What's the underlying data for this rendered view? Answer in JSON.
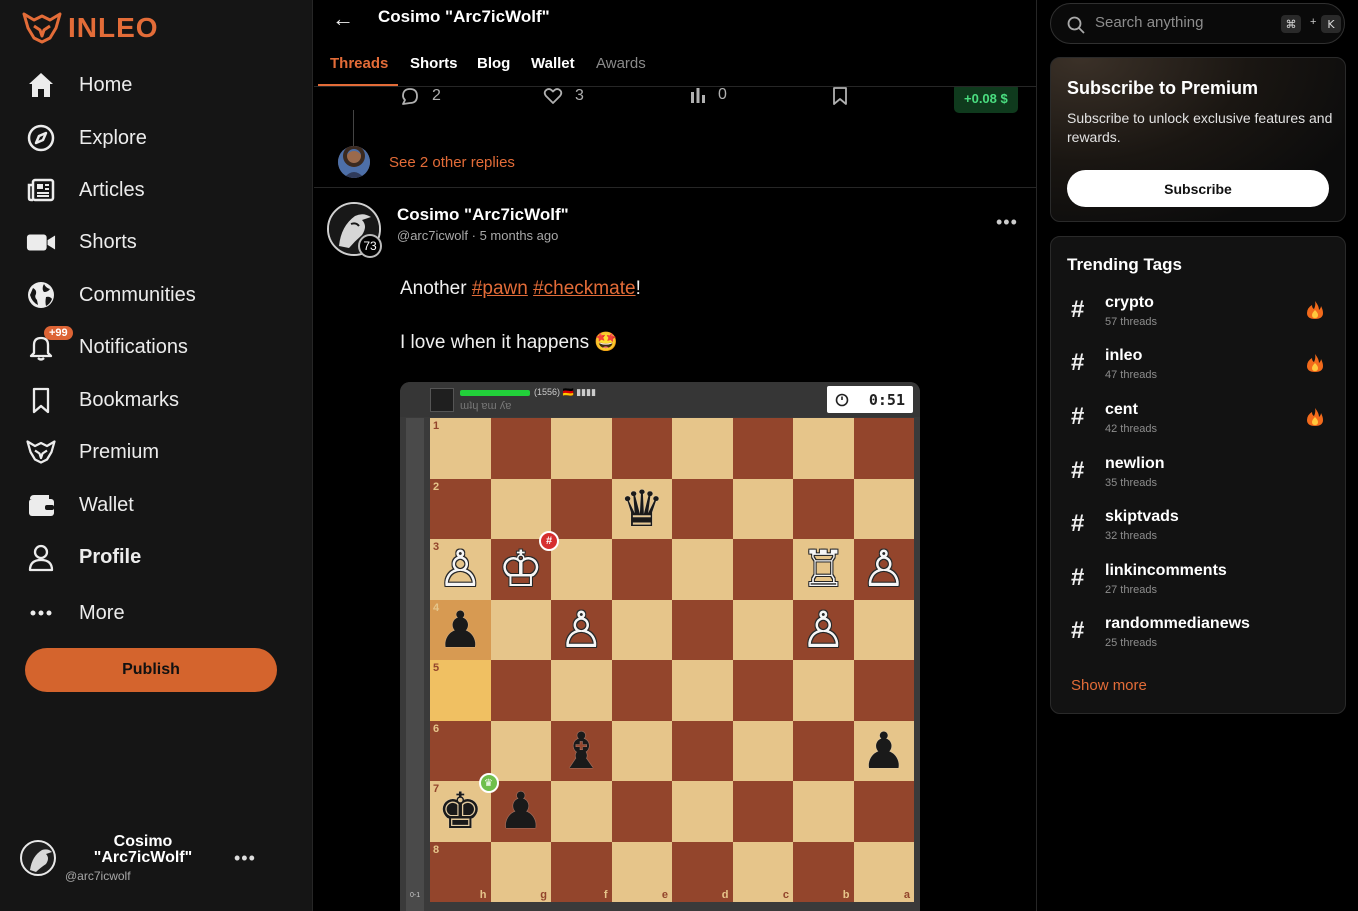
{
  "brand": {
    "name": "INLEO",
    "accent": "#e36c38"
  },
  "sidebar": {
    "items": [
      {
        "label": "Home",
        "icon": "home-icon"
      },
      {
        "label": "Explore",
        "icon": "compass-icon"
      },
      {
        "label": "Articles",
        "icon": "newspaper-icon"
      },
      {
        "label": "Shorts",
        "icon": "video-icon"
      },
      {
        "label": "Communities",
        "icon": "globe-icon"
      },
      {
        "label": "Notifications",
        "icon": "bell-icon",
        "badge": "+99"
      },
      {
        "label": "Bookmarks",
        "icon": "bookmark-icon"
      },
      {
        "label": "Premium",
        "icon": "leo-logo-icon"
      },
      {
        "label": "Wallet",
        "icon": "wallet-icon"
      },
      {
        "label": "Profile",
        "icon": "user-icon",
        "active": true
      },
      {
        "label": "More",
        "icon": "more-dots-icon"
      }
    ],
    "publish_label": "Publish",
    "account": {
      "name": "Cosimo \"Arc7icWolf\"",
      "handle": "@arc7icwolf",
      "menu": "•••"
    }
  },
  "header": {
    "back": "←",
    "title": "Cosimo \"Arc7icWolf\""
  },
  "tabs": [
    {
      "label": "Threads",
      "active": true
    },
    {
      "label": "Shorts"
    },
    {
      "label": "Blog"
    },
    {
      "label": "Wallet"
    },
    {
      "label": "Awards",
      "dim": true
    }
  ],
  "prev_post": {
    "comments": "2",
    "likes": "3",
    "views": "0",
    "earnings": "+0.08 $",
    "see_replies": "See 2 other replies"
  },
  "post": {
    "author": "Cosimo \"Arc7icWolf\"",
    "handle": "@arc7icwolf",
    "time": "5 months ago",
    "level": "73",
    "menu": "•••",
    "text_prefix": "Another ",
    "tag1": "#pawn",
    "tag2": "#checkmate",
    "text_suffix": "!",
    "line2": "I love when it happens 🤩"
  },
  "chess": {
    "clock": "0:51",
    "rating": "(1556) 🇩🇪 ▮▮▮▮",
    "opponent_handle": "ɯʇɥ ɐɯ ʎɐ",
    "side_label": "0-1",
    "files": [
      "h",
      "g",
      "f",
      "e",
      "d",
      "c",
      "b",
      "a"
    ],
    "ranks": [
      "1",
      "2",
      "3",
      "4",
      "5",
      "6",
      "7",
      "8"
    ],
    "pieces": {
      "2-4": "♛b",
      "3-1": "♙w",
      "3-2": "♔w",
      "3-7": "♖w",
      "3-8": "♙w",
      "4-1": "♟b",
      "4-3": "♙w",
      "4-7": "♙w",
      "6-3": "♝b",
      "6-8": "♟b",
      "7-1": "♚b",
      "7-2": "♟b"
    }
  },
  "right": {
    "search_placeholder": "Search anything",
    "kbd1": "⌘",
    "kbd_plus": "+",
    "kbd2": "K",
    "premium": {
      "title": "Subscribe to Premium",
      "text": "Subscribe to unlock exclusive features and rewards.",
      "button": "Subscribe"
    },
    "trending": {
      "title": "Trending Tags",
      "tags": [
        {
          "name": "crypto",
          "count": "57 threads",
          "hot": true
        },
        {
          "name": "inleo",
          "count": "47 threads",
          "hot": true
        },
        {
          "name": "cent",
          "count": "42 threads",
          "hot": true
        },
        {
          "name": "newlion",
          "count": "35 threads",
          "hot": false
        },
        {
          "name": "skiptvads",
          "count": "32 threads",
          "hot": false
        },
        {
          "name": "linkincomments",
          "count": "27 threads",
          "hot": false
        },
        {
          "name": "randommedianews",
          "count": "25 threads",
          "hot": false
        }
      ],
      "show_more": "Show more"
    }
  }
}
